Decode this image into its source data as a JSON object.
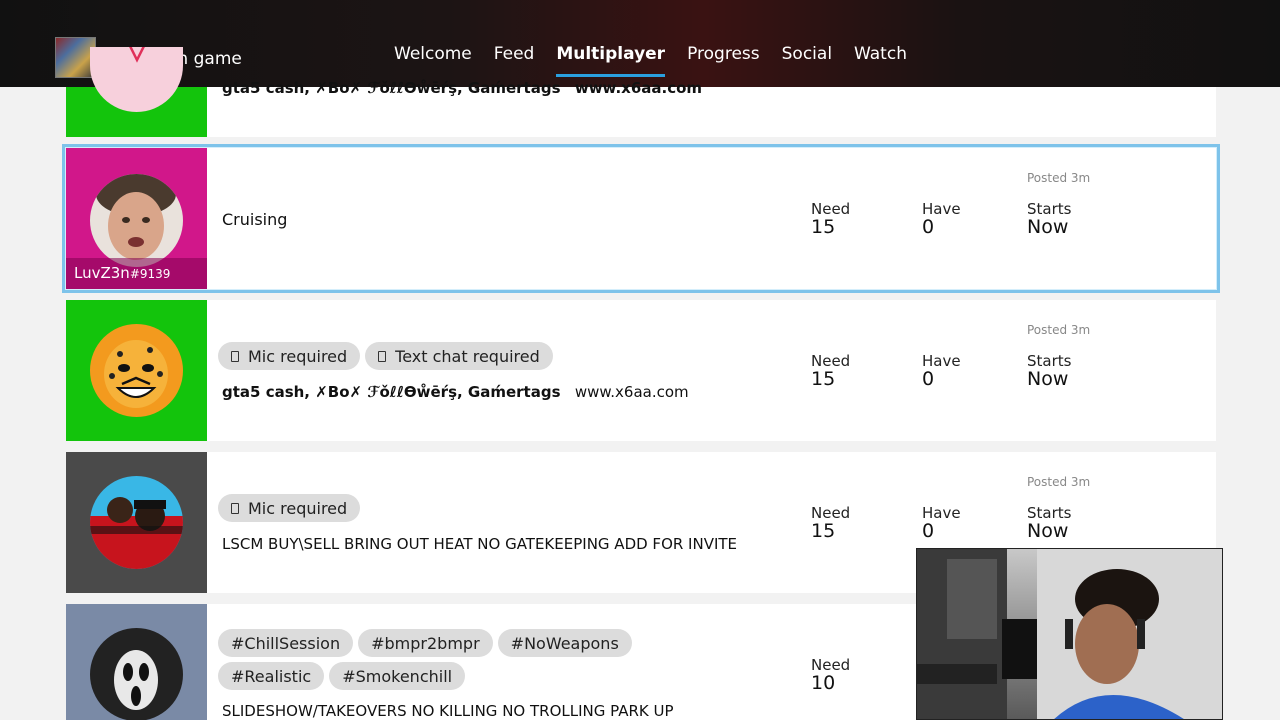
{
  "header": {
    "switch_game_label": "Switch game",
    "tabs": [
      {
        "label": "Welcome",
        "active": false
      },
      {
        "label": "Feed",
        "active": false
      },
      {
        "label": "Multiplayer",
        "active": true
      },
      {
        "label": "Progress",
        "active": false
      },
      {
        "label": "Social",
        "active": false
      },
      {
        "label": "Watch",
        "active": false
      }
    ],
    "accent_color": "#2aa0e0"
  },
  "labels": {
    "need": "Need",
    "have": "Have",
    "starts": "Starts"
  },
  "posts": [
    {
      "description_bold": "gta5 cash, ✗Bᴏ✗ ℱǒℓℓƟẘēŕş, Ǥaḿertags",
      "description_site": "www.x6aa.com",
      "tile_color": "#13c40c"
    },
    {
      "gamertag": "LuvZ3n",
      "gamertag_suffix": "#9139",
      "description": "Cruising",
      "posted": "Posted 3m",
      "need": "15",
      "have": "0",
      "starts": "Now",
      "tile_color": "#d1178a",
      "selected": true
    },
    {
      "tags": [
        "Mic required",
        "Text chat required"
      ],
      "description_bold": "gta5 cash, ✗Bᴏ✗ ℱǒℓℓƟẘēŕş, Ǥaḿertags",
      "description_site": "www.x6aa.com",
      "posted": "Posted 3m",
      "need": "15",
      "have": "0",
      "starts": "Now",
      "tile_color": "#13c40c"
    },
    {
      "tags": [
        "Mic required"
      ],
      "description": "LSCM BUY\\SELL BRING OUT HEAT NO GATEKEEPING ADD FOR INVITE",
      "posted": "Posted 3m",
      "need": "15",
      "have": "0",
      "starts": "Now",
      "tile_color": "#4a4a4a"
    },
    {
      "tags": [
        "#ChillSession",
        "#bmpr2bmpr",
        "#NoWeapons",
        "#Realistic",
        "#Smokenchill"
      ],
      "description": "SLIDESHOW/TAKEOVERS NO KILLING NO TROLLING PARK UP",
      "need": "10",
      "tile_color": "#7a8aa6"
    }
  ]
}
